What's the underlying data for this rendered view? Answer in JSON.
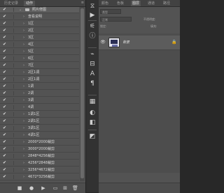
{
  "actions_panel": {
    "tabs": [
      {
        "label": "历史记录",
        "active": false
      },
      {
        "label": "动作",
        "active": true
      }
    ],
    "rows": [
      {
        "label": "照片修图",
        "type": "set",
        "selected": true
      },
      {
        "label": "查看说明",
        "type": "action"
      },
      {
        "label": "1区",
        "type": "action"
      },
      {
        "label": "2区",
        "type": "action"
      },
      {
        "label": "3区",
        "type": "action"
      },
      {
        "label": "4区",
        "type": "action"
      },
      {
        "label": "5区",
        "type": "action"
      },
      {
        "label": "6区",
        "type": "action"
      },
      {
        "label": "7区",
        "type": "action"
      },
      {
        "label": "2区1调",
        "type": "action"
      },
      {
        "label": "2区1调",
        "type": "action"
      },
      {
        "label": "1调",
        "type": "action"
      },
      {
        "label": "2调",
        "type": "action"
      },
      {
        "label": "3调",
        "type": "action"
      },
      {
        "label": "4调",
        "type": "action"
      },
      {
        "label": "1调1区",
        "type": "action"
      },
      {
        "label": "2调1区",
        "type": "action"
      },
      {
        "label": "3调1区",
        "type": "action"
      },
      {
        "label": "4调1区",
        "type": "action"
      },
      {
        "label": "2000*2000裁剪",
        "type": "action"
      },
      {
        "label": "3000*2000裁剪",
        "type": "action"
      },
      {
        "label": "2848*4256裁剪",
        "type": "action"
      },
      {
        "label": "4256*2848裁剪",
        "type": "action"
      },
      {
        "label": "3256*4672裁剪",
        "type": "action"
      },
      {
        "label": "4672*3256裁剪",
        "type": "action"
      }
    ],
    "check_glyph": "✔",
    "twisty_glyph": "›",
    "twisty_open_glyph": "⌄",
    "footer_icons": [
      "stop-icon",
      "record-icon",
      "play-icon",
      "new-set-icon",
      "new-action-icon",
      "delete-icon"
    ],
    "footer_glyphs": [
      "■",
      "●",
      "▶",
      "▭",
      "⊞",
      "🗑"
    ],
    "menu_glyph": "≡"
  },
  "tool_strip": {
    "icons": [
      {
        "name": "history-icon",
        "glyph": "⧖"
      },
      {
        "name": "actions-play-icon",
        "glyph": "▶"
      },
      {
        "name": "properties-icon",
        "glyph": "⚟"
      },
      {
        "name": "info-icon",
        "glyph": "ⓘ"
      },
      {
        "name": "brush-icon",
        "glyph": "⌁"
      },
      {
        "name": "brush-settings-icon",
        "glyph": "⊟"
      },
      {
        "name": "character-icon",
        "glyph": "A"
      },
      {
        "name": "paragraph-icon",
        "glyph": "¶"
      },
      {
        "name": "layer-comps-icon",
        "glyph": "▦"
      },
      {
        "name": "adjustments-icon",
        "glyph": "◐"
      },
      {
        "name": "styles-icon",
        "glyph": "◧"
      },
      {
        "name": "libraries-icon",
        "glyph": "◩"
      }
    ]
  },
  "layers_panel": {
    "tabs": [
      {
        "label": "颜色",
        "active": false
      },
      {
        "label": "色板",
        "active": false
      },
      {
        "label": "图层",
        "active": true
      },
      {
        "label": "通道",
        "active": false
      },
      {
        "label": "路径",
        "active": false
      }
    ],
    "filter_label": "类型",
    "blend_mode": "正常",
    "opacity_label": "不透明度:",
    "lock_label": "锁定:",
    "fill_label": "填充:",
    "layers": [
      {
        "name": "背景",
        "visible": true,
        "locked": true
      }
    ],
    "eye_glyph": "👁",
    "lock_glyph": "🔒"
  }
}
